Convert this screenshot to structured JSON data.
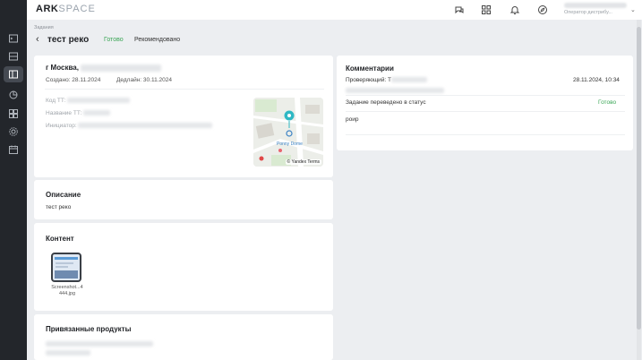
{
  "header": {
    "logo_main": "ARK",
    "logo_accent": "SPACE",
    "user_role": "Оператор дистрибу..."
  },
  "nav": {
    "breadcrumb": "Задания",
    "title": "тест реко",
    "tabs": [
      {
        "label": "Готово",
        "color": "#3aa655"
      },
      {
        "label": "Рекомендовано"
      }
    ]
  },
  "task": {
    "city": "г Москва,",
    "created": "Создано: 28.11.2024",
    "deadline": "Дедлайн: 30.11.2024",
    "fields": [
      {
        "label": "Код ТТ:"
      },
      {
        "label": "Название ТТ:"
      },
      {
        "label": "Инициатор:"
      }
    ],
    "map": {
      "poi": "Ponny Dome",
      "attribution": "© Yandex Terms"
    }
  },
  "description": {
    "title": "Описание",
    "text": "тест реко"
  },
  "content": {
    "title": "Контент",
    "file_line1": "Screenshot...4",
    "file_line2": "444.jpg"
  },
  "products": {
    "title": "Привязанные продукты"
  },
  "comments": {
    "title": "Комментарии",
    "reviewer_label": "Проверяющий: Т",
    "timestamp": "28.11.2024, 10:34",
    "status_change_text": "Задание переведено в статус",
    "status_value": "Готово",
    "comment_text": "роир"
  },
  "colors": {
    "accent_green": "#3aa655",
    "sidebar_bg": "#23262b",
    "page_bg": "#eceef1"
  }
}
